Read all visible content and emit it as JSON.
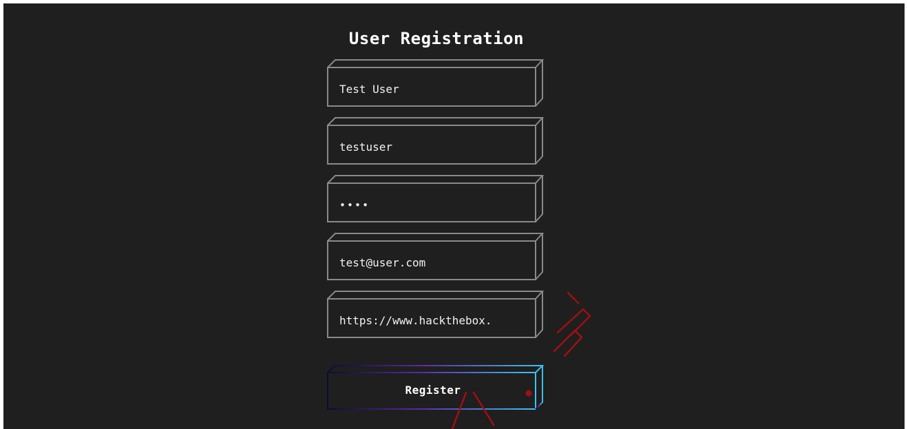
{
  "form": {
    "title": "User Registration",
    "fields": [
      {
        "name": "full-name",
        "value": "Test User"
      },
      {
        "name": "username",
        "value": "testuser"
      },
      {
        "name": "password",
        "value": "••••"
      },
      {
        "name": "email",
        "value": "test@user.com"
      },
      {
        "name": "website",
        "value": "https://www.hackthebox."
      }
    ],
    "register_label": "Register"
  },
  "colors": {
    "background": "#1f1f1f",
    "field_border": "#8a8a8a",
    "button_gradient_start": "#0d0b33",
    "button_gradient_mid": "#5b2ca8",
    "button_gradient_end": "#39c6f2",
    "watermark": "#a01010"
  }
}
